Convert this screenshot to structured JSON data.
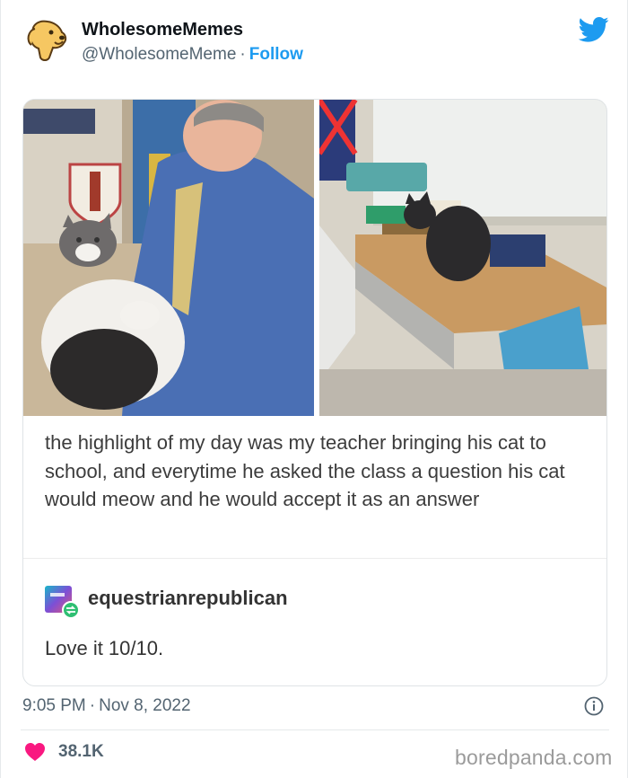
{
  "tweet": {
    "author_name": "WholesomeMemes",
    "author_handle": "@WholesomeMeme",
    "separator": "·",
    "follow_label": "Follow",
    "avatar_icon": "dog-avatar-icon",
    "platform_icon": "twitter-bird-icon",
    "accent_color": "#1d9bf0",
    "time": "9:05 PM",
    "date": "Nov 8, 2022",
    "like_count": "38.1K",
    "like_color": "#f91880"
  },
  "post": {
    "text": "the highlight of my day was my teacher bringing his cat to school, and everytime he asked the class a question his cat would meow and he would accept it as an answer",
    "reblog_user": "equestrianrepublican",
    "reblog_comment": "Love it 10/10."
  },
  "watermark": "boredpanda.com"
}
